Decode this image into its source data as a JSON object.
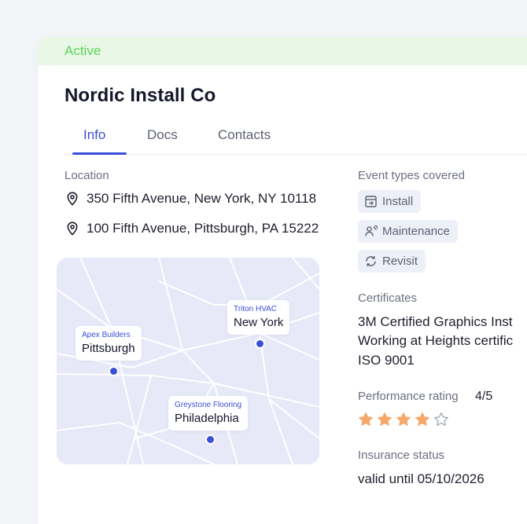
{
  "status": {
    "label": "Active",
    "color": "#5cd45a",
    "background": "#e9f8e6"
  },
  "company": {
    "name": "Nordic Install Co"
  },
  "tabs": [
    {
      "label": "Info",
      "active": true
    },
    {
      "label": "Docs",
      "active": false
    },
    {
      "label": "Contacts",
      "active": false
    }
  ],
  "location": {
    "label": "Location",
    "addresses": [
      {
        "text": "350 Fifth Avenue, New York, NY 10118",
        "icon": "map-pin-icon"
      },
      {
        "text": "100 Fifth Avenue, Pittsburgh, PA 15222",
        "icon": "map-pin-icon"
      }
    ]
  },
  "map": {
    "markers": [
      {
        "company": "Apex Builders",
        "city": "Pittsburgh"
      },
      {
        "company": "Triton HVAC",
        "city": "New York"
      },
      {
        "company": "Greystone Flooring",
        "city": "Philadelphia"
      }
    ]
  },
  "event_types": {
    "label": "Event types covered",
    "items": [
      {
        "label": "Install",
        "icon": "install-box-icon"
      },
      {
        "label": "Maintenance",
        "icon": "maintenance-person-icon"
      },
      {
        "label": "Revisit",
        "icon": "revisit-cycle-icon"
      }
    ]
  },
  "certificates": {
    "label": "Certificates",
    "items": [
      "3M Certified Graphics Inst",
      "Working at Heights certific",
      "ISO 9001"
    ]
  },
  "performance": {
    "label": "Performance rating",
    "value": "4/5",
    "rating": 4,
    "max": 5,
    "star_color": "#f5a86a"
  },
  "insurance": {
    "label": "Insurance status",
    "value": "valid until 05/10/2026"
  },
  "accent_color": "#3a4fd8"
}
